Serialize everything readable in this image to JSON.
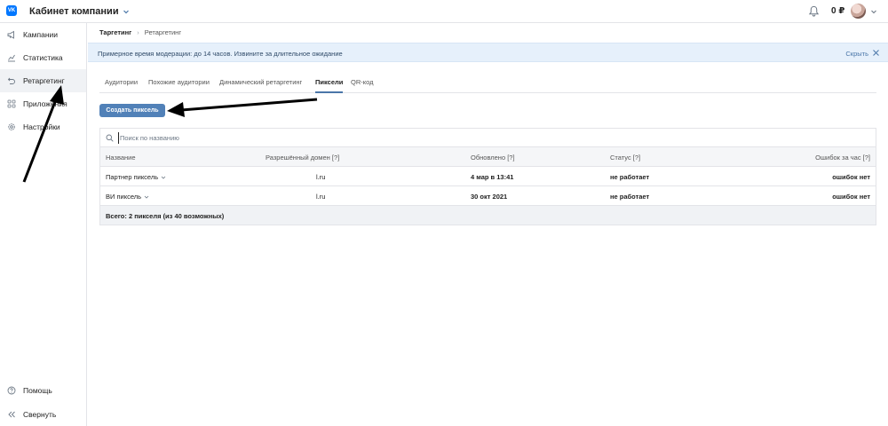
{
  "header": {
    "logo_text": "VK",
    "cabinet_title": "Кабинет компании",
    "balance": "0 ₽"
  },
  "sidebar": {
    "items": [
      {
        "label": "Кампании",
        "icon": "megaphone-icon"
      },
      {
        "label": "Статистика",
        "icon": "chart-icon"
      },
      {
        "label": "Ретаргетинг",
        "icon": "retarget-icon",
        "active": true
      },
      {
        "label": "Приложения",
        "icon": "apps-grid-icon"
      },
      {
        "label": "Настройки",
        "icon": "gear-icon"
      }
    ],
    "help": "Помощь",
    "collapse": "Свернуть"
  },
  "breadcrumb": {
    "first": "Таргетинг",
    "second": "Ретаргетинг"
  },
  "notice": {
    "text": "Примерное время модерации: до 14 часов. Извините за длительное ожидание",
    "hide": "Скрыть"
  },
  "tabs": [
    {
      "label": "Аудитории"
    },
    {
      "label": "Похожие аудитории"
    },
    {
      "label": "Динамический ретаргетинг"
    },
    {
      "label": "Пиксели",
      "active": true
    },
    {
      "label": "QR-код"
    }
  ],
  "create_button": "Создать пиксель",
  "search": {
    "placeholder": "Поиск по названию"
  },
  "table": {
    "columns": [
      "Название",
      "Разрешённый домен [?]",
      "Обновлено [?]",
      "Статус [?]",
      "Ошибок за час [?]"
    ],
    "rows": [
      {
        "name": "Партнер пиксель",
        "domain": "l.ru",
        "updated": "4 мар в 13:41",
        "status": "не работает",
        "errors": "ошибок нет"
      },
      {
        "name": "ВИ пиксель",
        "domain": "l.ru",
        "updated": "30 окт 2021",
        "status": "не работает",
        "errors": "ошибок нет"
      }
    ],
    "footer": "Всего: 2 пикселя (из 40 возможных)"
  },
  "colors": {
    "accent": "#5181b8",
    "link": "#2a5885",
    "notice_bg": "#e6f0fb",
    "vk_blue": "#0077ff"
  }
}
